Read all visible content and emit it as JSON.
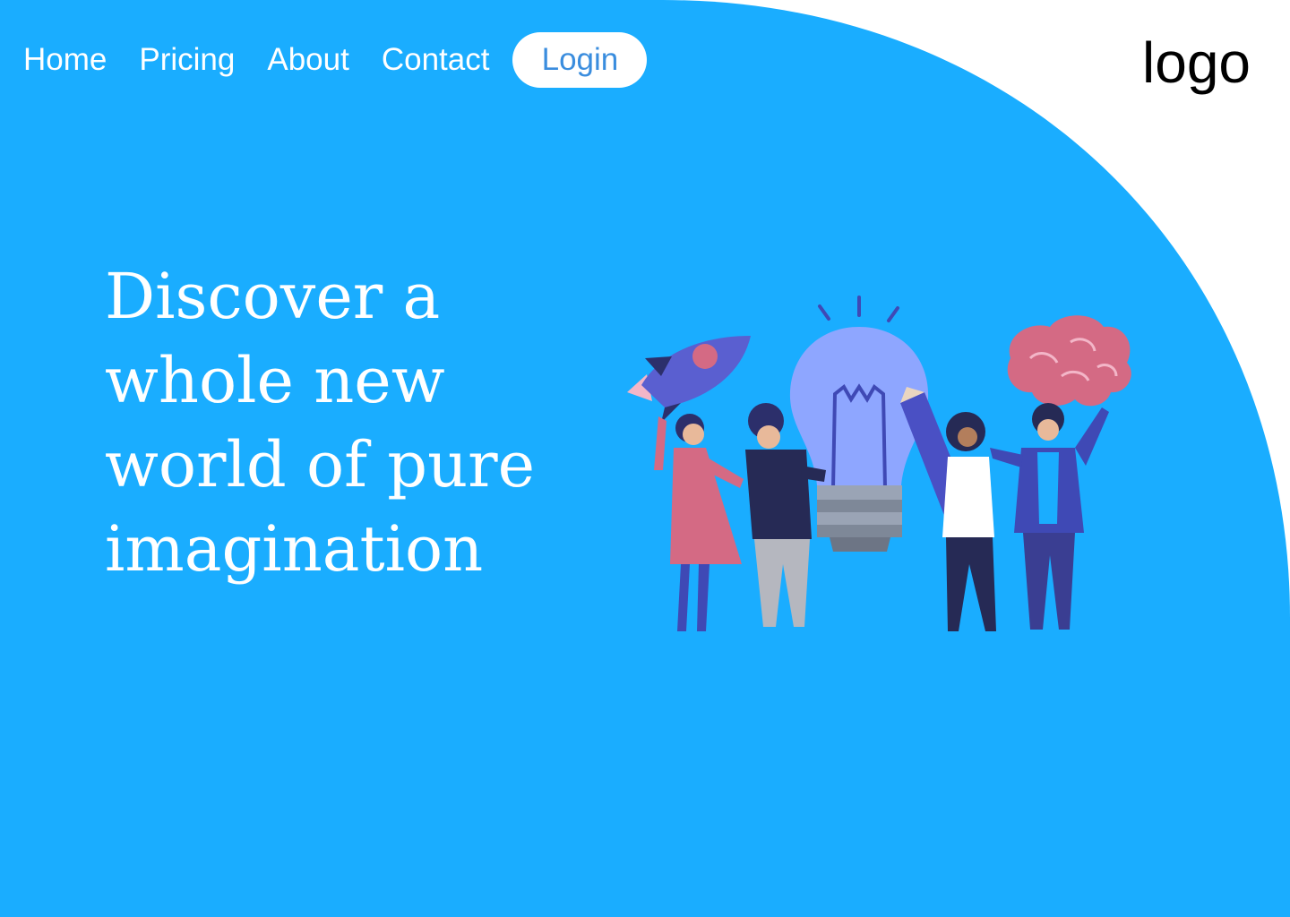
{
  "nav": {
    "links": [
      {
        "label": "Home"
      },
      {
        "label": "Pricing"
      },
      {
        "label": "About"
      },
      {
        "label": "Contact"
      }
    ],
    "login_label": "Login"
  },
  "logo": {
    "text": "logo"
  },
  "hero": {
    "headline": "Discover a whole new world of pure imagination",
    "illustration_icon": "team-idea-illustration-icon"
  },
  "colors": {
    "background_accent": "#1aadff",
    "page_background": "#ffffff",
    "login_text": "#3a8dde",
    "logo_text": "#000000"
  }
}
